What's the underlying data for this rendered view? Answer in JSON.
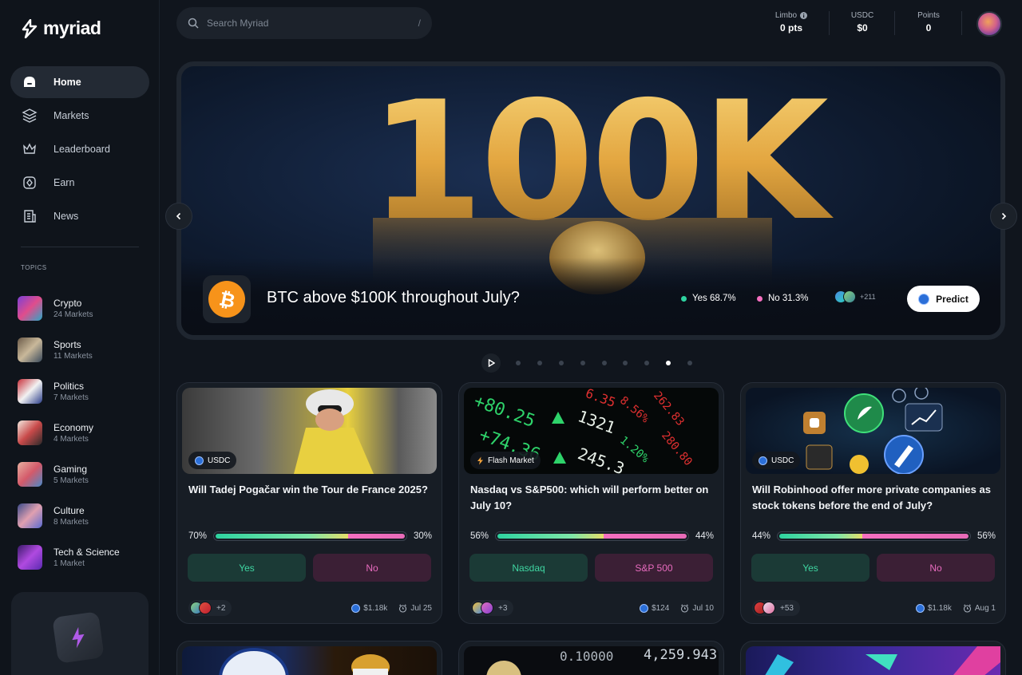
{
  "app": {
    "name": "myriad"
  },
  "nav": [
    {
      "label": "Home",
      "icon": "home-icon",
      "active": true
    },
    {
      "label": "Markets",
      "icon": "layers-icon"
    },
    {
      "label": "Leaderboard",
      "icon": "crown-icon"
    },
    {
      "label": "Earn",
      "icon": "diamond-icon"
    },
    {
      "label": "News",
      "icon": "news-icon"
    }
  ],
  "topics_title": "TOPICS",
  "topics": [
    {
      "name": "Crypto",
      "count": "24 Markets"
    },
    {
      "name": "Sports",
      "count": "11 Markets"
    },
    {
      "name": "Politics",
      "count": "7 Markets"
    },
    {
      "name": "Economy",
      "count": "4 Markets"
    },
    {
      "name": "Gaming",
      "count": "5 Markets"
    },
    {
      "name": "Culture",
      "count": "8 Markets"
    },
    {
      "name": "Tech & Science",
      "count": "1 Market"
    }
  ],
  "search": {
    "placeholder": "Search Myriad",
    "shortcut": "/"
  },
  "stats": [
    {
      "label": "Limbo",
      "value": "0 pts"
    },
    {
      "label": "USDC",
      "value": "$0"
    },
    {
      "label": "Points",
      "value": "0"
    }
  ],
  "hero": {
    "art_text": "100K",
    "title": "BTC above $100K throughout July?",
    "yes": "Yes 68.7%",
    "no": "No 31.3%",
    "participants_more": "+211",
    "predict_label": "Predict"
  },
  "carousel": {
    "count": 9,
    "active_index": 7
  },
  "cards": [
    {
      "badge": "USDC",
      "question": "Will Tadej Pogačar win the Tour de France 2025?",
      "yes_pct": "70%",
      "no_pct": "30%",
      "yes_fraction": 0.7,
      "yes_label": "Yes",
      "no_label": "No",
      "participants_more": "+2",
      "volume": "$1.18k",
      "date": "Jul 25"
    },
    {
      "badge": "Flash Market",
      "question": "Nasdaq vs S&P500: which will perform better on July 10?",
      "yes_pct": "56%",
      "no_pct": "44%",
      "yes_fraction": 0.56,
      "yes_label": "Nasdaq",
      "no_label": "S&P 500",
      "participants_more": "+3",
      "volume": "$124",
      "date": "Jul 10"
    },
    {
      "badge": "USDC",
      "question": "Will Robinhood offer more private companies as stock tokens before the end of July?",
      "yes_pct": "44%",
      "no_pct": "56%",
      "yes_fraction": 0.44,
      "yes_label": "Yes",
      "no_label": "No",
      "participants_more": "+53",
      "volume": "$1.18k",
      "date": "Aug 1"
    }
  ],
  "colors": {
    "yes": "#3fd6a2",
    "no": "#e76bbe",
    "btc": "#f7931a"
  }
}
